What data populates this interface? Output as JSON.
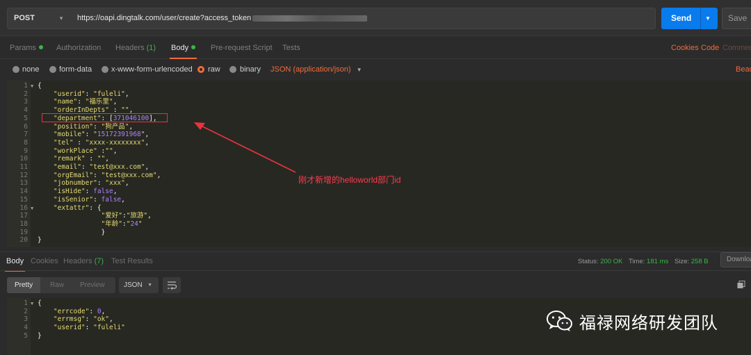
{
  "request": {
    "method": "POST",
    "url": "https://oapi.dingtalk.com/user/create?access_token",
    "send_label": "Send",
    "save_label": "Save"
  },
  "req_tabs": [
    {
      "label": "Params"
    },
    {
      "label": "Authorization"
    },
    {
      "label": "Headers",
      "count": "(1)"
    },
    {
      "label": "Body"
    },
    {
      "label": "Pre-request Script"
    },
    {
      "label": "Tests"
    }
  ],
  "right_links": {
    "cookies": "Cookies",
    "code": "Code",
    "comments": "Commen"
  },
  "body_types": {
    "none": "none",
    "form_data": "form-data",
    "urlencoded": "x-www-form-urlencoded",
    "raw": "raw",
    "binary": "binary",
    "json_select": "JSON (application/json)",
    "beautify": "Beau"
  },
  "request_code": [
    "{",
    "    \"userid\": \"fuleli\",",
    "    \"name\": \"福乐里\",",
    "    \"orderInDepts\" : \"\",",
    "    \"department\": [371046100],",
    "    \"position\": \"狗产品\",",
    "    \"mobile\": \"15172391968\",",
    "    \"tel\" : \"xxxx-xxxxxxxx\",",
    "    \"workPlace\" :\"\",",
    "    \"remark\" : \"\",",
    "    \"email\": \"test@xxx.com\",",
    "    \"orgEmail\": \"test@xxx.com\",",
    "    \"jobnumber\": \"xxx\",",
    "    \"isHide\": false,",
    "    \"isSenior\": false,",
    "    \"extattr\": {",
    "                \"爱好\":\"旅游\",",
    "                \"年龄\":\"24\"",
    "                }",
    "}"
  ],
  "annotation": "刚才新增的helloworld部门id",
  "resp_tabs": [
    {
      "label": "Body"
    },
    {
      "label": "Cookies"
    },
    {
      "label": "Headers",
      "count": "(7)"
    },
    {
      "label": "Test Results"
    }
  ],
  "status": {
    "status_label": "Status:",
    "status_value": "200 OK",
    "time_label": "Time:",
    "time_value": "181 ms",
    "size_label": "Size:",
    "size_value": "258 B"
  },
  "download_label": "Download",
  "view_modes": [
    "Pretty",
    "Raw",
    "Preview"
  ],
  "format": "JSON",
  "response_code": [
    "{",
    "    \"errcode\": 0,",
    "    \"errmsg\": \"ok\",",
    "    \"userid\": \"fuleli\"",
    "}"
  ],
  "watermark": "福禄网络研发团队",
  "colors": {
    "accent": "#f26b3a",
    "send": "#097bed",
    "success": "#3ab54a",
    "annotation": "#e8343f"
  }
}
